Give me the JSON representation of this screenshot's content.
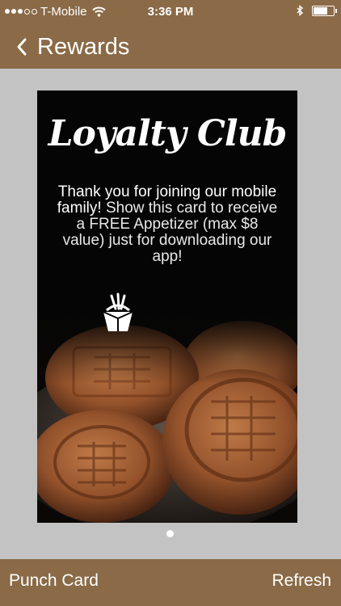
{
  "status_bar": {
    "carrier": "T-Mobile",
    "time": "3:36 PM",
    "signal_bars_filled": 3,
    "signal_bars_total": 5,
    "battery_level": 0.7
  },
  "nav": {
    "title": "Rewards",
    "back_icon": "chevron-left-icon"
  },
  "card": {
    "title": "Loyalty Club",
    "message_bold": "Thank you for joining our mobile family!",
    "message_rest": " Show this card to receive a FREE Appetizer (max $8 value) just for downloading our app!",
    "icon": "noodle-box-icon"
  },
  "pager": {
    "current_page": 1,
    "page_count": 1
  },
  "toolbar": {
    "left_label": "Punch Card",
    "right_label": "Refresh"
  },
  "colors": {
    "brand_brown": "#8a6a47",
    "background_gray": "#c3c3c3",
    "card_black": "#050505"
  }
}
